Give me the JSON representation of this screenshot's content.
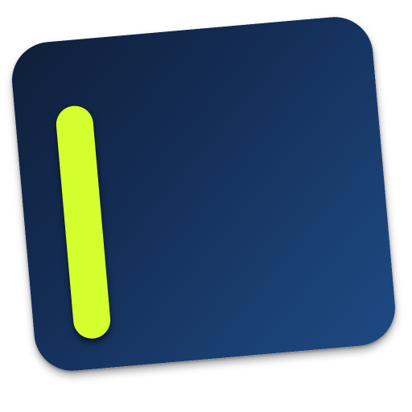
{
  "app_icon": {
    "icon_name": "vertical-bar-logo-icon",
    "colors": {
      "tile_dark": "#0f1f3a",
      "tile_light": "#1e4a82",
      "accent_bar": "#d4ff2e",
      "background": "#ffffff"
    }
  }
}
